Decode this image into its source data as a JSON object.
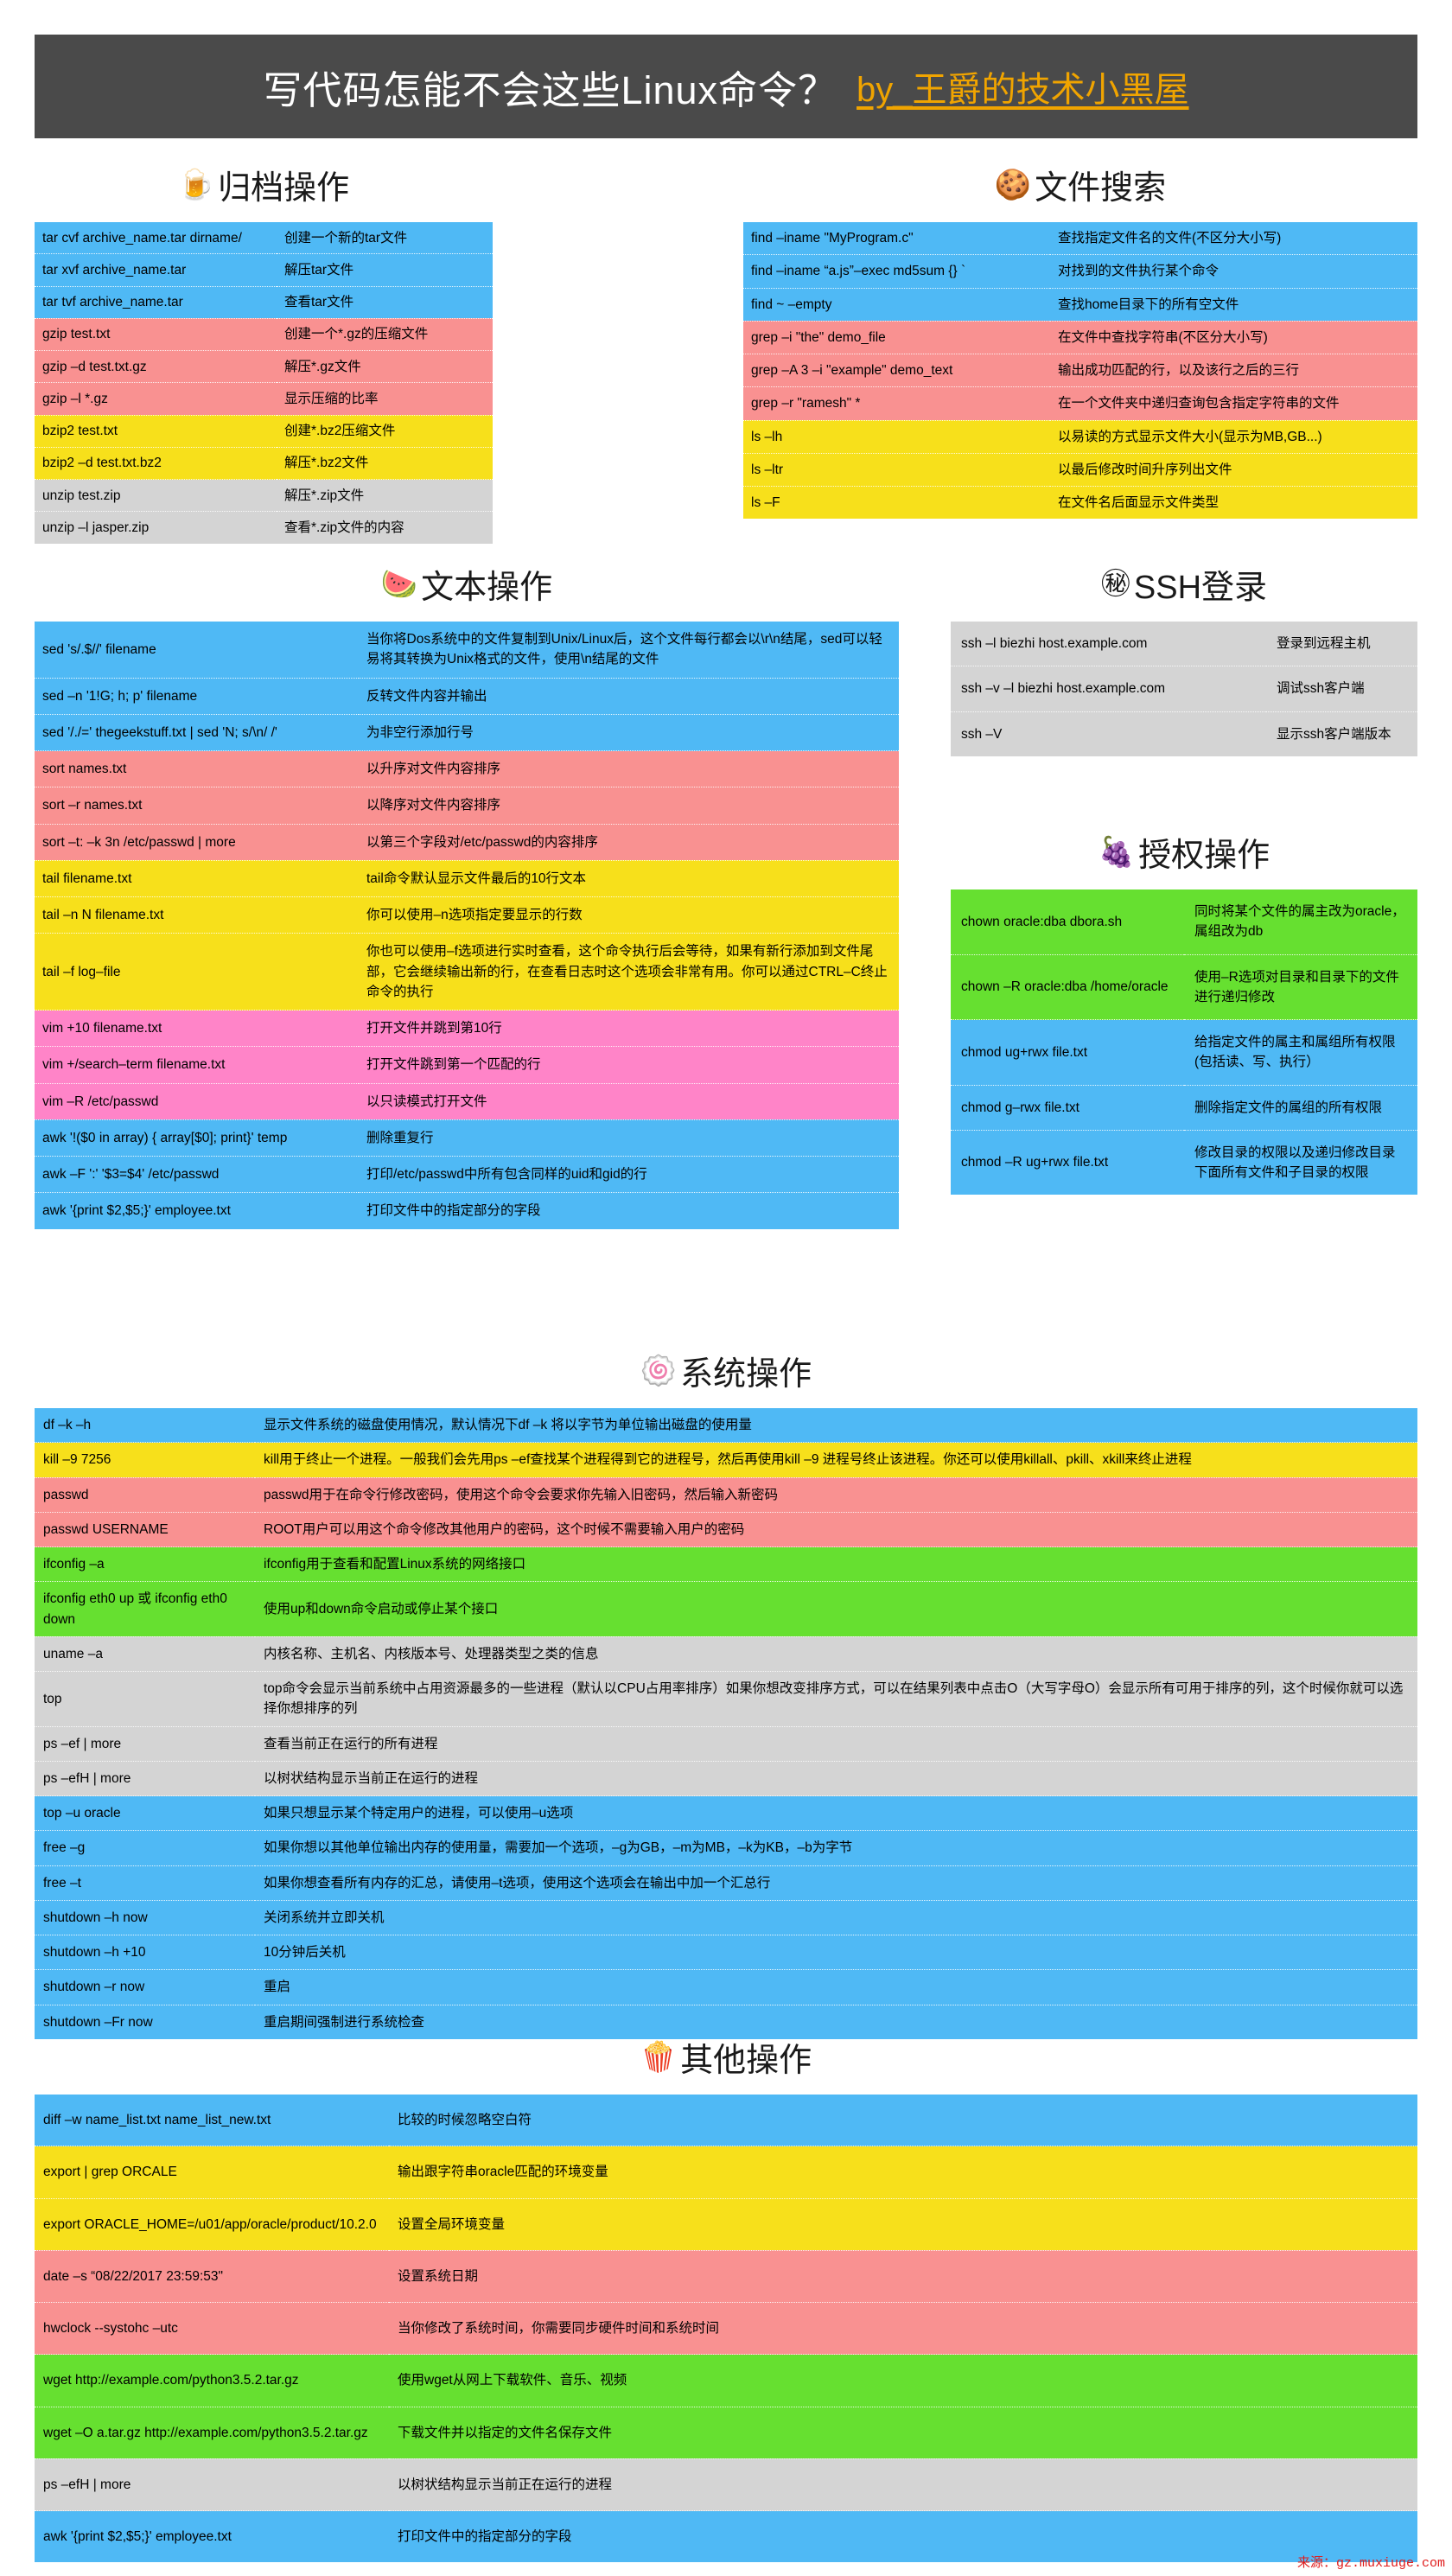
{
  "header": {
    "title": "写代码怎能不会这些Linux命令？",
    "by": "by_王爵的技术小黑屋",
    "bg_color": "#4a4a4a",
    "title_color": "#ffffff",
    "by_color": "#f0a400"
  },
  "palette": {
    "blue": "#4fb9f5",
    "red": "#f99191",
    "yellow": "#f7e01b",
    "gray": "#d4d4d4",
    "pink": "#ff84c8",
    "green": "#66e030"
  },
  "sections": {
    "archive": {
      "icon": "beer-mug-icon",
      "emoji": "🍺",
      "title": "归档操作",
      "rows": [
        {
          "cmd": "tar cvf archive_name.tar dirname/",
          "desc": "创建一个新的tar文件",
          "color": "blue"
        },
        {
          "cmd": "tar xvf archive_name.tar",
          "desc": "解压tar文件",
          "color": "blue"
        },
        {
          "cmd": "tar tvf archive_name.tar",
          "desc": "查看tar文件",
          "color": "blue"
        },
        {
          "cmd": "gzip test.txt",
          "desc": "创建一个*.gz的压缩文件",
          "color": "red"
        },
        {
          "cmd": "gzip –d test.txt.gz",
          "desc": "解压*.gz文件",
          "color": "red"
        },
        {
          "cmd": "gzip –l *.gz",
          "desc": "显示压缩的比率",
          "color": "red"
        },
        {
          "cmd": "bzip2 test.txt",
          "desc": "创建*.bz2压缩文件",
          "color": "yellow"
        },
        {
          "cmd": "bzip2 –d test.txt.bz2",
          "desc": "解压*.bz2文件",
          "color": "yellow"
        },
        {
          "cmd": "unzip test.zip",
          "desc": "解压*.zip文件",
          "color": "gray"
        },
        {
          "cmd": "unzip –l jasper.zip",
          "desc": "查看*.zip文件的内容",
          "color": "gray"
        }
      ]
    },
    "search": {
      "icon": "cookie-icon",
      "emoji": "🍪",
      "title": "文件搜索",
      "rows": [
        {
          "cmd": "find –iname \"MyProgram.c\"",
          "desc": "查找指定文件名的文件(不区分大小写)",
          "color": "blue"
        },
        {
          "cmd": "find –iname “a.js”–exec md5sum {} `",
          "desc": "对找到的文件执行某个命令",
          "color": "blue"
        },
        {
          "cmd": "find ~ –empty",
          "desc": "查找home目录下的所有空文件",
          "color": "blue"
        },
        {
          "cmd": "grep –i \"the\" demo_file",
          "desc": "在文件中查找字符串(不区分大小写)",
          "color": "red"
        },
        {
          "cmd": "grep –A 3 –i \"example\" demo_text",
          "desc": "输出成功匹配的行，以及该行之后的三行",
          "color": "red"
        },
        {
          "cmd": "grep –r \"ramesh\" *",
          "desc": "在一个文件夹中递归查询包含指定字符串的文件",
          "color": "red"
        },
        {
          "cmd": "ls –lh",
          "desc": "以易读的方式显示文件大小(显示为MB,GB...)",
          "color": "yellow"
        },
        {
          "cmd": "ls –ltr",
          "desc": "以最后修改时间升序列出文件",
          "color": "yellow"
        },
        {
          "cmd": "ls –F",
          "desc": "在文件名后面显示文件类型",
          "color": "yellow"
        }
      ]
    },
    "text": {
      "icon": "watermelon-icon",
      "emoji": "🍉",
      "title": "文本操作",
      "rows": [
        {
          "cmd": "sed 's/.$//' filename",
          "desc": "当你将Dos系统中的文件复制到Unix/Linux后，这个文件每行都会以\\r\\n结尾，sed可以轻易将其转换为Unix格式的文件，使用\\n结尾的文件",
          "color": "blue"
        },
        {
          "cmd": "sed –n '1!G; h; p' filename",
          "desc": "反转文件内容并输出",
          "color": "blue"
        },
        {
          "cmd": "sed '/./=' thegeekstuff.txt | sed 'N; s/\\n/ /'",
          "desc": "为非空行添加行号",
          "color": "blue"
        },
        {
          "cmd": "sort names.txt",
          "desc": "以升序对文件内容排序",
          "color": "red"
        },
        {
          "cmd": "sort –r names.txt",
          "desc": "以降序对文件内容排序",
          "color": "red"
        },
        {
          "cmd": "sort –t: –k 3n /etc/passwd | more",
          "desc": "以第三个字段对/etc/passwd的内容排序",
          "color": "red"
        },
        {
          "cmd": "tail filename.txt",
          "desc": "tail命令默认显示文件最后的10行文本",
          "color": "yellow"
        },
        {
          "cmd": "tail –n N filename.txt",
          "desc": "你可以使用–n选项指定要显示的行数",
          "color": "yellow"
        },
        {
          "cmd": "tail –f log–file",
          "desc": "你也可以使用–f选项进行实时查看，这个命令执行后会等待，如果有新行添加到文件尾部，它会继续输出新的行，在查看日志时这个选项会非常有用。你可以通过CTRL–C终止命令的执行",
          "color": "yellow"
        },
        {
          "cmd": "vim +10 filename.txt",
          "desc": "打开文件并跳到第10行",
          "color": "pink"
        },
        {
          "cmd": "vim +/search–term filename.txt",
          "desc": "打开文件跳到第一个匹配的行",
          "color": "pink"
        },
        {
          "cmd": "vim –R /etc/passwd",
          "desc": "以只读模式打开文件",
          "color": "pink"
        },
        {
          "cmd": "awk '!($0 in array) { array[$0]; print}' temp",
          "desc": "删除重复行",
          "color": "blue"
        },
        {
          "cmd": "awk –F ':' '$3=$4' /etc/passwd",
          "desc": "打印/etc/passwd中所有包含同样的uid和gid的行",
          "color": "blue"
        },
        {
          "cmd": "awk '{print $2,$5;}' employee.txt",
          "desc": "打印文件中的指定部分的字段",
          "color": "blue"
        }
      ]
    },
    "ssh": {
      "icon": "secret-icon",
      "emoji": "㊙",
      "title": "SSH登录",
      "rows": [
        {
          "cmd": "ssh –l biezhi host.example.com",
          "desc": "登录到远程主机",
          "color": "gray"
        },
        {
          "cmd": "ssh –v –l biezhi host.example.com",
          "desc": "调试ssh客户端",
          "color": "gray"
        },
        {
          "cmd": "ssh –V",
          "desc": "显示ssh客户端版本",
          "color": "gray"
        }
      ]
    },
    "auth": {
      "icon": "grapes-icon",
      "emoji": "🍇",
      "title": "授权操作",
      "rows": [
        {
          "cmd": "chown oracle:dba dbora.sh",
          "desc": "同时将某个文件的属主改为oracle，属组改为db",
          "color": "green"
        },
        {
          "cmd": "chown –R oracle:dba /home/oracle",
          "desc": "使用–R选项对目录和目录下的文件进行递归修改",
          "color": "green"
        },
        {
          "cmd": "chmod ug+rwx file.txt",
          "desc": "给指定文件的属主和属组所有权限(包括读、写、执行）",
          "color": "blue"
        },
        {
          "cmd": "chmod g–rwx file.txt",
          "desc": "删除指定文件的属组的所有权限",
          "color": "blue"
        },
        {
          "cmd": "chmod –R ug+rwx file.txt",
          "desc": "修改目录的权限以及递归修改目录下面所有文件和子目录的权限",
          "color": "blue"
        }
      ]
    },
    "system": {
      "icon": "fish-cake-icon",
      "emoji": "🍥",
      "title": "系统操作",
      "rows": [
        {
          "cmd": "df –k –h",
          "desc": "显示文件系统的磁盘使用情况，默认情况下df –k 将以字节为单位输出磁盘的使用量",
          "color": "blue"
        },
        {
          "cmd": "kill –9 7256",
          "desc": "kill用于终止一个进程。一般我们会先用ps –ef查找某个进程得到它的进程号，然后再使用kill –9 进程号终止该进程。你还可以使用killall、pkill、xkill来终止进程",
          "color": "yellow"
        },
        {
          "cmd": "passwd",
          "desc": "passwd用于在命令行修改密码，使用这个命令会要求你先输入旧密码，然后输入新密码",
          "color": "red"
        },
        {
          "cmd": "passwd USERNAME",
          "desc": "ROOT用户可以用这个命令修改其他用户的密码，这个时候不需要输入用户的密码",
          "color": "red"
        },
        {
          "cmd": "ifconfig –a",
          "desc": "ifconfig用于查看和配置Linux系统的网络接口",
          "color": "green"
        },
        {
          "cmd": "ifconfig eth0 up 或 ifconfig eth0 down",
          "desc": "使用up和down命令启动或停止某个接口",
          "color": "green"
        },
        {
          "cmd": "uname –a",
          "desc": "内核名称、主机名、内核版本号、处理器类型之类的信息",
          "color": "gray"
        },
        {
          "cmd": "top",
          "desc": "top命令会显示当前系统中占用资源最多的一些进程（默认以CPU占用率排序）如果你想改变排序方式，可以在结果列表中点击O（大写字母O）会显示所有可用于排序的列，这个时候你就可以选择你想排序的列",
          "color": "gray"
        },
        {
          "cmd": "ps –ef | more",
          "desc": "查看当前正在运行的所有进程",
          "color": "gray"
        },
        {
          "cmd": "ps –efH | more",
          "desc": "以树状结构显示当前正在运行的进程",
          "color": "gray"
        },
        {
          "cmd": "top –u oracle",
          "desc": "如果只想显示某个特定用户的进程，可以使用–u选项",
          "color": "blue"
        },
        {
          "cmd": "free –g",
          "desc": "如果你想以其他单位输出内存的使用量，需要加一个选项，–g为GB，–m为MB，–k为KB，–b为字节",
          "color": "blue"
        },
        {
          "cmd": "free –t",
          "desc": "如果你想查看所有内存的汇总，请使用–t选项，使用这个选项会在输出中加一个汇总行",
          "color": "blue"
        },
        {
          "cmd": "shutdown –h now",
          "desc": "关闭系统并立即关机",
          "color": "blue"
        },
        {
          "cmd": "shutdown –h +10",
          "desc": "10分钟后关机",
          "color": "blue"
        },
        {
          "cmd": "shutdown –r now",
          "desc": "重启",
          "color": "blue"
        },
        {
          "cmd": "shutdown –Fr now",
          "desc": "重启期间强制进行系统检查",
          "color": "blue"
        }
      ]
    },
    "other": {
      "icon": "popcorn-icon",
      "emoji": "🍿",
      "title": "其他操作",
      "rows": [
        {
          "cmd": "diff –w name_list.txt name_list_new.txt",
          "desc": "比较的时候忽略空白符",
          "color": "blue"
        },
        {
          "cmd": "export | grep ORCALE",
          "desc": "输出跟字符串oracle匹配的环境变量",
          "color": "yellow"
        },
        {
          "cmd": "export ORACLE_HOME=/u01/app/oracle/product/10.2.0",
          "desc": "设置全局环境变量",
          "color": "yellow"
        },
        {
          "cmd": "date –s “08/22/2017 23:59:53\"",
          "desc": "设置系统日期",
          "color": "red"
        },
        {
          "cmd": "hwclock --systohc –utc",
          "desc": "当你修改了系统时间，你需要同步硬件时间和系统时间",
          "color": "red"
        },
        {
          "cmd": "wget http://example.com/python3.5.2.tar.gz",
          "desc": "使用wget从网上下载软件、音乐、视频",
          "color": "green"
        },
        {
          "cmd": "wget –O a.tar.gz http://example.com/python3.5.2.tar.gz",
          "desc": "下载文件并以指定的文件名保存文件",
          "color": "green"
        },
        {
          "cmd": "ps –efH | more",
          "desc": "以树状结构显示当前正在运行的进程",
          "color": "gray"
        },
        {
          "cmd": "awk '{print $2,$5;}' employee.txt",
          "desc": "打印文件中的指定部分的字段",
          "color": "blue"
        }
      ]
    }
  },
  "footer": {
    "source": "来源：gz.muxiuge.com",
    "color": "#e01b1b"
  }
}
